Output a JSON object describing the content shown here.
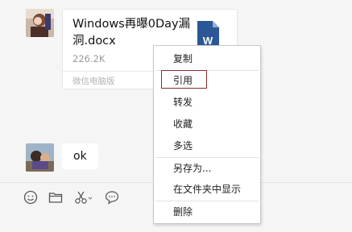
{
  "file_message": {
    "file_name": "Windows再曝0Day漏洞.docx",
    "file_size": "226.2K",
    "source": "微信电脑版",
    "file_icon": "word-document-icon"
  },
  "text_message": {
    "text": "ok"
  },
  "toolbar": {
    "items": [
      {
        "icon": "emoji-icon"
      },
      {
        "icon": "folder-icon"
      },
      {
        "icon": "scissors-icon"
      },
      {
        "icon": "chat-bubble-icon"
      }
    ]
  },
  "context_menu": {
    "items": [
      {
        "label": "复制"
      },
      {
        "label": "引用"
      },
      {
        "label": "转发"
      },
      {
        "label": "收藏"
      },
      {
        "label": "多选"
      },
      {
        "label": "另存为..."
      },
      {
        "label": "在文件夹中显示"
      },
      {
        "label": "删除"
      }
    ],
    "highlighted_index": 1
  },
  "colors": {
    "chat_bg": "#f5f5f5",
    "doc_icon_blue": "#2b5797",
    "highlight_border": "#8b2b2b"
  }
}
